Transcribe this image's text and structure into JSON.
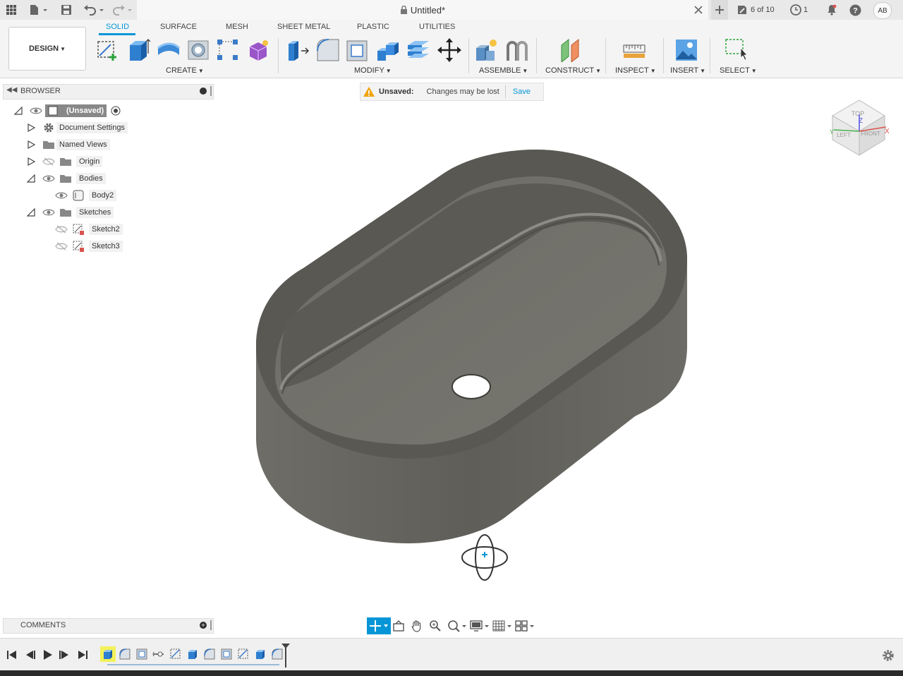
{
  "app": {
    "doc_title": "Untitled*",
    "job_status": "6 of 10",
    "history_count": "1",
    "user_initials": "AB"
  },
  "ribbon": {
    "workspace": "DESIGN",
    "tabs": [
      {
        "label": "SOLID"
      },
      {
        "label": "SURFACE"
      },
      {
        "label": "MESH"
      },
      {
        "label": "SHEET METAL"
      },
      {
        "label": "PLASTIC"
      },
      {
        "label": "UTILITIES"
      }
    ],
    "groups": {
      "create": "CREATE",
      "modify": "MODIFY",
      "assemble": "ASSEMBLE",
      "construct": "CONSTRUCT",
      "inspect": "INSPECT",
      "insert": "INSERT",
      "select": "SELECT"
    }
  },
  "browser": {
    "title": "BROWSER",
    "root": "(Unsaved)",
    "items": [
      {
        "label": "Document Settings"
      },
      {
        "label": "Named Views"
      },
      {
        "label": "Origin"
      },
      {
        "label": "Bodies"
      },
      {
        "label": "Body2"
      },
      {
        "label": "Sketches"
      },
      {
        "label": "Sketch2"
      },
      {
        "label": "Sketch3"
      }
    ]
  },
  "banner": {
    "title": "Unsaved:",
    "message": "Changes may be lost",
    "action": "Save"
  },
  "viewcube": {
    "top": "TOP",
    "front": "FRONT",
    "left": "LEFT",
    "axis_x": "X",
    "axis_y": "Y",
    "axis_z": "Z"
  },
  "comments": {
    "title": "COMMENTS"
  },
  "colors": {
    "accent": "#0696d7",
    "body": "#6b6a64",
    "warning": "#f0a30a"
  }
}
